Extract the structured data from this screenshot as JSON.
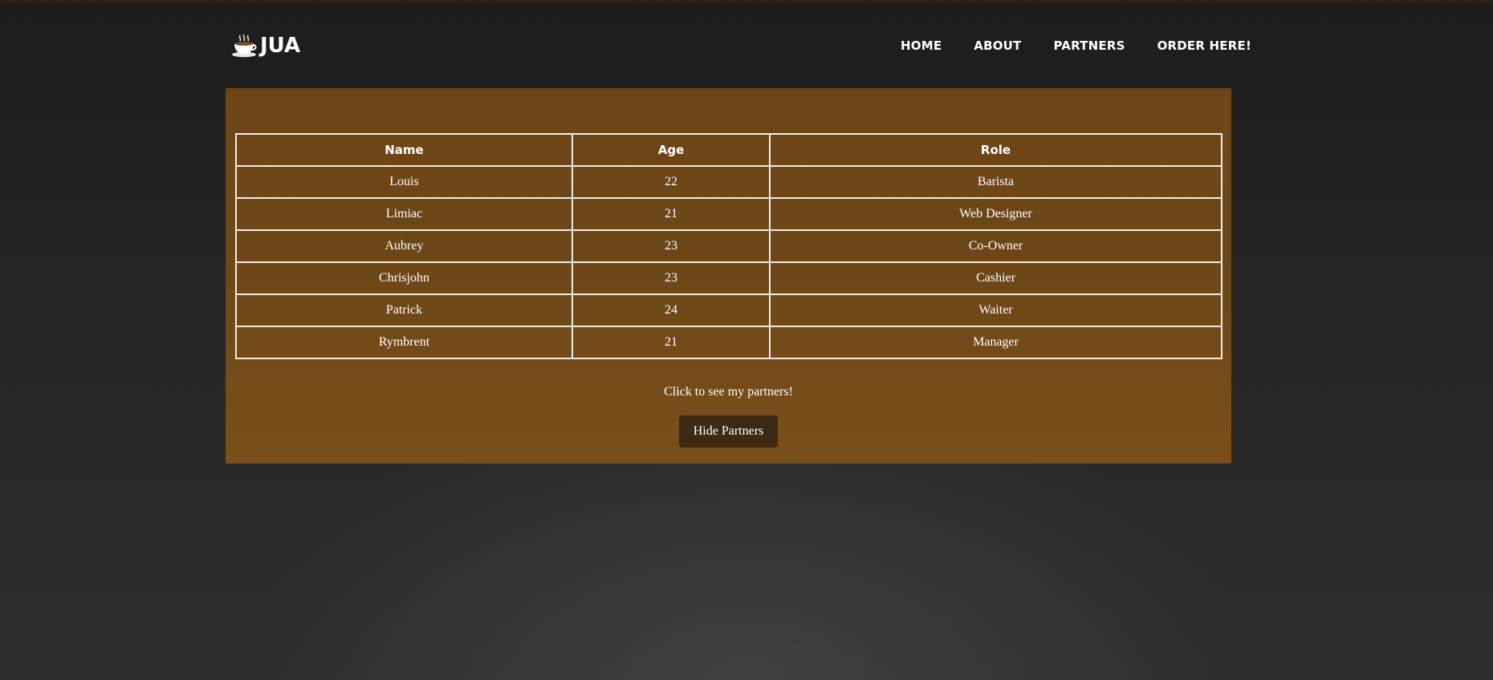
{
  "brand": {
    "name": "JUA",
    "icon": "coffee-cup-icon"
  },
  "nav": {
    "items": [
      {
        "label": "HOME"
      },
      {
        "label": "ABOUT"
      },
      {
        "label": "PARTNERS"
      },
      {
        "label": "ORDER HERE!"
      }
    ]
  },
  "partners": {
    "columns": [
      "Name",
      "Age",
      "Role"
    ],
    "rows": [
      {
        "name": "Louis",
        "age": "22",
        "role": "Barista"
      },
      {
        "name": "Limiac",
        "age": "21",
        "role": "Web Designer"
      },
      {
        "name": "Aubrey",
        "age": "23",
        "role": "Co-Owner"
      },
      {
        "name": "Chrisjohn",
        "age": "23",
        "role": "Cashier"
      },
      {
        "name": "Patrick",
        "age": "24",
        "role": "Waiter"
      },
      {
        "name": "Rymbrent",
        "age": "21",
        "role": "Manager"
      }
    ],
    "caption": "Click to see my partners!",
    "toggle_label": "Hide Partners"
  },
  "colors": {
    "panel": "#6e4517",
    "button": "#3e2912",
    "background": "#262626",
    "table_border": "#f2ede6"
  }
}
